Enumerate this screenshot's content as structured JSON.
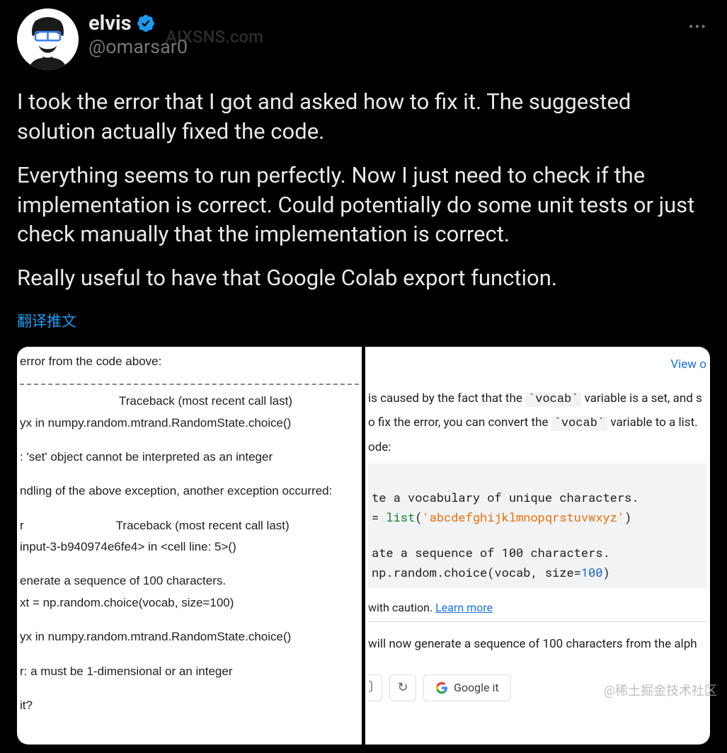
{
  "user": {
    "display_name": "elvis",
    "handle": "@omarsar0"
  },
  "watermark_top": "AIXSNS.com",
  "tweet": {
    "p1": "I took the error that I got and asked how to fix it. The suggested solution actually fixed the code.",
    "p2": "Everything seems to run perfectly. Now I just need to check if the implementation is correct. Could potentially do some unit tests or just check manually that the implementation is correct.",
    "p3": "Really useful to have that Google Colab export function."
  },
  "translate_label": "翻译推文",
  "left_pane": {
    "l1": "error from the code above:",
    "l2": "Traceback (most recent call last)",
    "l3": "yx in numpy.random.mtrand.RandomState.choice()",
    "l4": ": 'set' object cannot be interpreted as an integer",
    "l5": "ndling of the above exception, another exception occurred:",
    "l6": "r",
    "l6b": "Traceback (most recent call last)",
    "l7": "input-3-b940974e6fe4> in <cell line: 5>()",
    "l8": "enerate a sequence of 100 characters.",
    "l9": "xt = np.random.choice(vocab, size=100)",
    "l10": "yx in numpy.random.mtrand.RandomState.choice()",
    "l11": "r: a must be 1-dimensional or an integer",
    "l12": "it?"
  },
  "right_pane": {
    "view": "View o",
    "p1a": "is caused by the fact that the ",
    "vocab1": "`vocab`",
    "p1b": " variable is a set, and s",
    "p2a": "o fix the error, you can convert the ",
    "vocab2": "`vocab`",
    "p2b": " variable to a list.",
    "p3": "ode:",
    "code1": "te a vocabulary of unique characters.",
    "code2a": "= ",
    "code2b": "list",
    "code2c": "(",
    "code2d": "'abcdefghijklmnopqrstuvwxyz'",
    "code2e": ")",
    "code3": "ate a sequence of 100 characters.",
    "code4a": "np.random.choice(vocab, size=",
    "code4b": "100",
    "code4c": ")",
    "caution": "with caution. ",
    "learn_more": "Learn more",
    "p4": "will now generate a sequence of 100 characters from the alph",
    "google_it": "Google it"
  },
  "footer_watermark": "@稀土掘金技术社区"
}
